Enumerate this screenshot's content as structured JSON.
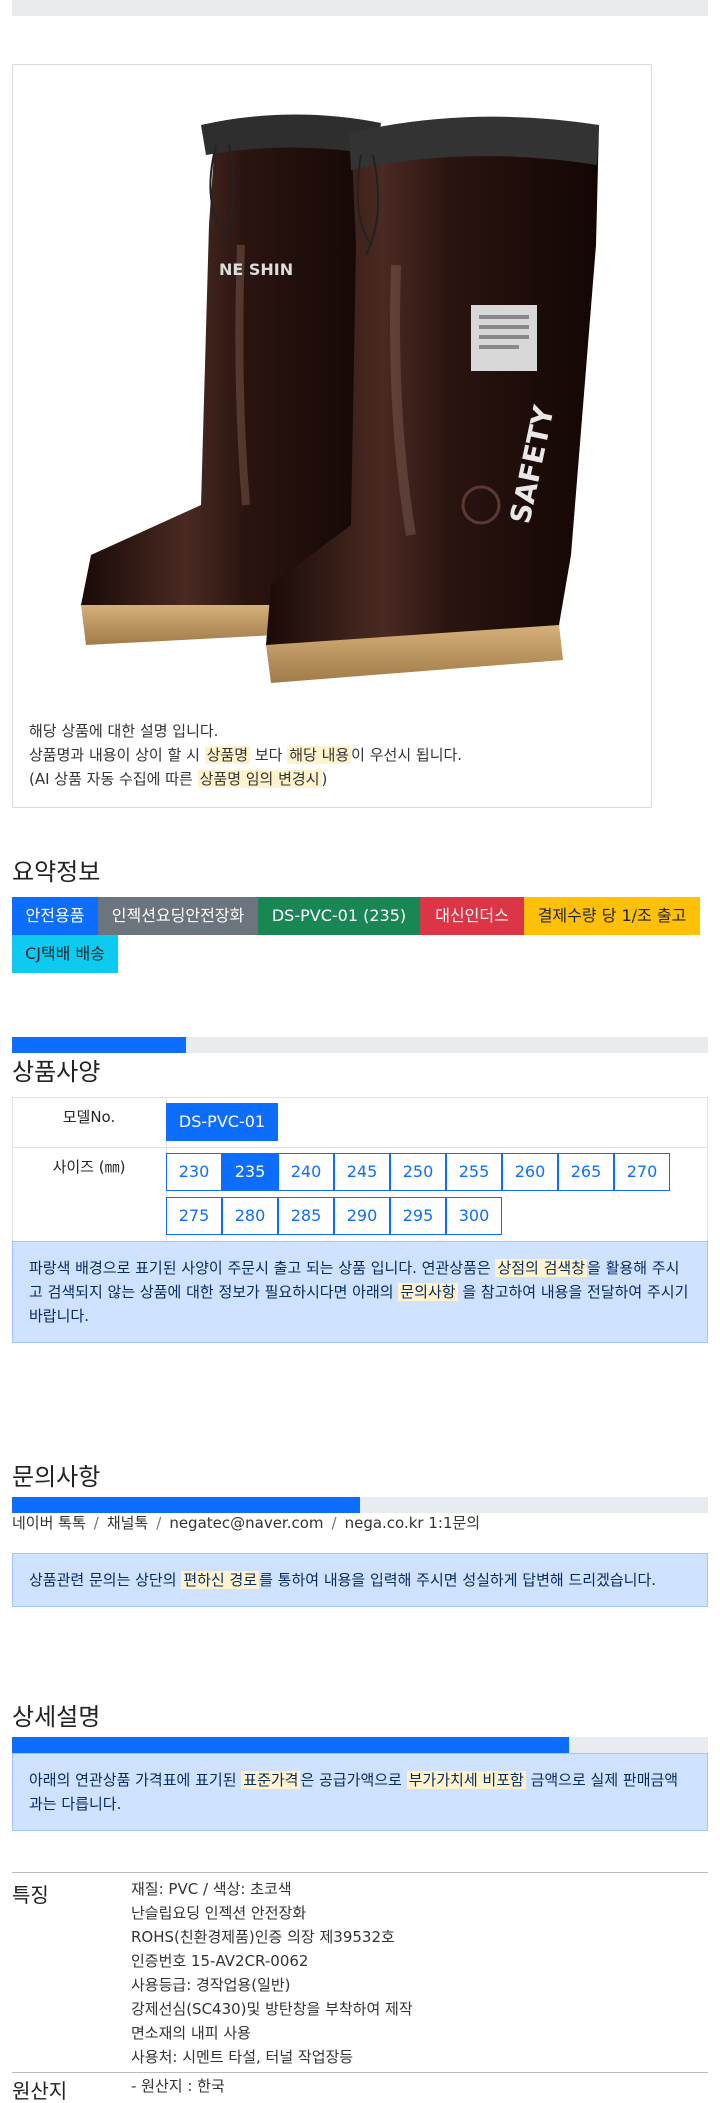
{
  "product": {
    "desc_line1": "해당 상품에 대한 설명 입니다.",
    "desc_line2_a": "상품명과 내용이 상이 할 시 ",
    "desc_line2_hl1": "상품명",
    "desc_line2_b": " 보다 ",
    "desc_line2_hl2": "해당 내용",
    "desc_line2_c": "이 우선시 됩니다.",
    "desc_line3_a": "(AI 상품 자동 수집에 따른 ",
    "desc_line3_hl": "상품명 임의 변경시",
    "desc_line3_b": ")",
    "boot_brand": "NE SHIN",
    "boot_side": "SAFETY",
    "colors": {
      "boot": "#2a1410",
      "sole": "#c9a06a"
    }
  },
  "summary": {
    "title": "요약정보",
    "badges": [
      {
        "label": "안전용품",
        "color": "#0d6efd"
      },
      {
        "label": "인젝션요딩안전장화",
        "color": "#6c757d"
      },
      {
        "label": "DS-PVC-01 (235)",
        "color": "#198754"
      },
      {
        "label": "대신인더스",
        "color": "#dc3545"
      },
      {
        "label": "결제수량 당 1/조 출고",
        "color": "#ffc107"
      },
      {
        "label": "CJ택배 배송",
        "color": "#0dcaf0"
      }
    ]
  },
  "spec": {
    "title": "상품사양",
    "progress_pct": 25,
    "model_label": "모델No.",
    "model_value": "DS-PVC-01",
    "size_label": "사이즈 (㎜)",
    "sizes": [
      "230",
      "235",
      "240",
      "245",
      "250",
      "255",
      "260",
      "265",
      "270",
      "275",
      "280",
      "285",
      "290",
      "295",
      "300"
    ],
    "selected_size": "235",
    "notice_a": "파랑색 배경으로 표기된 사양이 주문시 출고 되는 상품 입니다. 연관상품은 ",
    "notice_hl1": "상점의 검색창",
    "notice_b": "을 활용해 주시고 검색되지 않는 상품에 대한 정보가 필요하시다면 아래의 ",
    "notice_hl2": "문의사항",
    "notice_c": " 을 참고하여 내용을 전달하여 주시기 바랍니다."
  },
  "inquiry": {
    "title": "문의사항",
    "progress_pct": 50,
    "contacts": [
      "네이버 톡톡",
      "채널톡",
      "negatec@naver.com",
      "nega.co.kr 1:1문의"
    ],
    "notice_a": "상품관련 문의는 상단의 ",
    "notice_hl": "편하신 경로",
    "notice_b": "를 통하여 내용을 입력해 주시면 성실하게 답변해 드리겠습니다."
  },
  "detail": {
    "title": "상세설명",
    "progress_pct": 80,
    "notice_a": "아래의 연관상품 가격표에 표기된 ",
    "notice_hl1": "표준가격",
    "notice_b": "은 공급가액으로 ",
    "notice_hl2": "부가가치세 비포함",
    "notice_c": " 금액으로 실제 판매금액과는 다릅니다."
  },
  "features": {
    "label": "특징",
    "lines": [
      "재질: PVC / 색상: 초코색",
      "난슬립요딩 인젝션 안전장화",
      "ROHS(친환경제품)인증 의장 제39532호",
      "인증번호 15-AV2CR-0062",
      "사용등급: 경작업용(일반)",
      "강제선심(SC430)및 방탄창을 부착하여 제작",
      "면소재의 내피 사용",
      "사용처: 시멘트 타설, 터널 작업장등"
    ],
    "origin_label": "원산지",
    "origin_value": "- 원산지 : 한국"
  }
}
